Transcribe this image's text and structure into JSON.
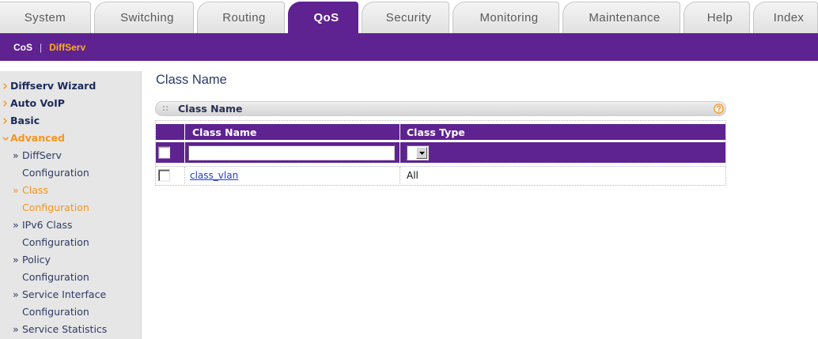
{
  "tabs": [
    {
      "label": "System",
      "active": false
    },
    {
      "label": "Switching",
      "active": false
    },
    {
      "label": "Routing",
      "active": false
    },
    {
      "label": "QoS",
      "active": true
    },
    {
      "label": "Security",
      "active": false
    },
    {
      "label": "Monitoring",
      "active": false
    },
    {
      "label": "Maintenance",
      "active": false
    },
    {
      "label": "Help",
      "active": false
    },
    {
      "label": "Index",
      "active": false
    }
  ],
  "subnav": {
    "separator": "|",
    "items": [
      {
        "label": "CoS",
        "active": false
      },
      {
        "label": "DiffServ",
        "active": true
      }
    ]
  },
  "sidebar": {
    "sub_marker": "»",
    "items": [
      {
        "label": "Diffserv Wizard",
        "icon": "chevron-right-icon",
        "active": false
      },
      {
        "label": "Auto VoIP",
        "icon": "chevron-right-icon",
        "active": false
      },
      {
        "label": "Basic",
        "icon": "chevron-right-icon",
        "active": false
      },
      {
        "label": "Advanced",
        "icon": "chevron-down-icon",
        "active": true,
        "expanded": true,
        "children": [
          {
            "line1": "DiffServ",
            "line2": "Configuration",
            "active": false
          },
          {
            "line1": "Class",
            "line2": "Configuration",
            "active": true
          },
          {
            "line1": "IPv6 Class",
            "line2": "Configuration",
            "active": false
          },
          {
            "line1": "Policy",
            "line2": "Configuration",
            "active": false
          },
          {
            "line1": "Service Interface",
            "line2": "Configuration",
            "active": false
          },
          {
            "line1": "Service Statistics",
            "active": false
          }
        ]
      }
    ]
  },
  "main": {
    "page_title": "Class Name",
    "panel": {
      "title": "Class Name",
      "grip_icon": "grip-icon",
      "help_icon": "help-icon"
    },
    "table": {
      "columns": [
        "Class Name",
        "Class Type"
      ],
      "new_row": {
        "selected": false,
        "class_name": "",
        "class_type": ""
      },
      "rows": [
        {
          "selected": false,
          "class_name": "class_vlan",
          "class_type": "All"
        }
      ]
    }
  },
  "colors": {
    "brand_purple": "#5f2291",
    "accent_orange": "#f7941d",
    "subnav_active": "#fbb117",
    "link_blue": "#1f3fcc",
    "nav_text": "#1c2a5a",
    "title_text": "#2b3b6c"
  }
}
